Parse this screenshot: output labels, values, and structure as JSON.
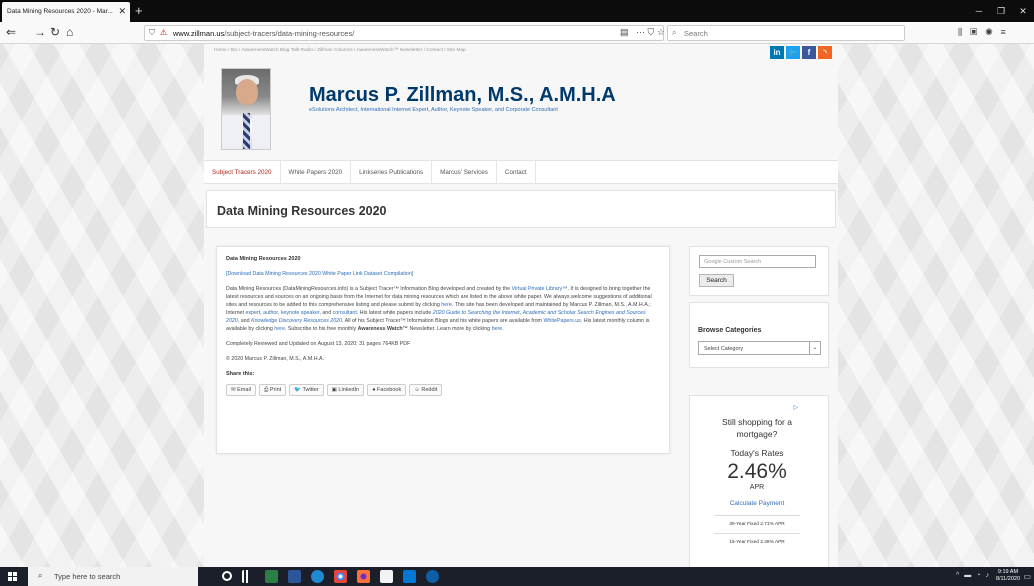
{
  "browser": {
    "tab_title": "Data Mining Resources 2020 - Mar...",
    "url_path": "/subject-tracers/data-mining-resources/",
    "url_host": "www.zillman.us",
    "search_placeholder": "Search"
  },
  "site": {
    "breadcrumb": "Home  /  Bio  /  AwarenessWatch Blog Talk Radio  /  Zillman Columns  /  AwarenessWatch™ Newsletter  /  Contact  /  Site Map",
    "title": "Marcus P. Zillman, M.S., A.M.H.A",
    "subtitle": "eSolutions Architect, International Internet Expert, Author, Keynote Speaker, and Corporate Consultant",
    "social": [
      "in",
      "t",
      "f",
      "rss"
    ]
  },
  "menu": [
    {
      "label": "Subject Tracers 2020",
      "active": true
    },
    {
      "label": "White Papers 2020"
    },
    {
      "label": "Linkseries Publications"
    },
    {
      "label": "Marcus' Services"
    },
    {
      "label": "Contact"
    }
  ],
  "page_title": "Data Mining Resources 2020",
  "content": {
    "heading": "Data Mining Resources 2020",
    "download_link": "[Download Data Mining Resources 2020 White Paper Link Dataset Compilation]",
    "body_1": "Data Mining Resources (DataMiningResources.info) is a Subject Tracer™ Information Blog developed and created by the ",
    "link_vpl": "Virtual Private Library™",
    "body_2": ". It is designed to bring together the latest resources and sources on an ongoing basis from the Internet for data mining resources which are listed in the above white paper. We always welcome suggestions of additional sites and resources to be added to this comprehensive listing and please submit by clicking ",
    "link_here1": "here",
    "body_3": ". This site has been developed and maintained by Marcus P. Zillman, M.S., A.M.H.A.; Internet ",
    "link_expert": "expert",
    "link_author": "author",
    "link_keynote": "keynote speaker",
    "body_4": ", and ",
    "link_consultant": "consultant",
    "body_5": ". His latest white papers include ",
    "link_wp1": "2020 Guide to Searching the Internet",
    "link_wp2": "Academic and Scholar Search Engines and Sources 2020",
    "link_wp3": "Knowledge Discovery Resources 2020",
    "body_6": ". All of his Subject Tracer™ Information Blogs and his white papers are available from ",
    "link_whitepapers": "WhitePapers.us",
    "body_7": ". His latest monthly column is available by clicking ",
    "link_here2": "here",
    "body_8": ". Subscribe to his free monthly ",
    "newsletter": "Awareness Watch™",
    "body_9": " Newsletter. Learn more by clicking ",
    "link_here3": "here",
    "updated": "Completely Reviewed and Updated on August 13, 2020; 31 pages 764KB PDF",
    "copyright": "© 2020 Marcus P. Zillman, M.S., A.M.H.A.",
    "share_heading": "Share this:",
    "share_buttons": [
      "Email",
      "Print",
      "Twitter",
      "LinkedIn",
      "Facebook",
      "Reddit"
    ]
  },
  "sidebar": {
    "search_placeholder": "Google  Custom Search",
    "search_button": "Search",
    "categories_heading": "Browse Categories",
    "categories_select": "Select Category"
  },
  "ad": {
    "line1": "Still shopping for a mortgage?",
    "line2": "Today's Rates",
    "rate": "2.46%",
    "apr": "APR",
    "cta": "Calculate Payment",
    "row1": "30-Year Fixed   2.71% APR",
    "row2": "15-Year Fixed   2.46% APR"
  },
  "taskbar": {
    "search_placeholder": "Type here to search",
    "time": "9:19 AM",
    "date": "8/11/2020"
  }
}
